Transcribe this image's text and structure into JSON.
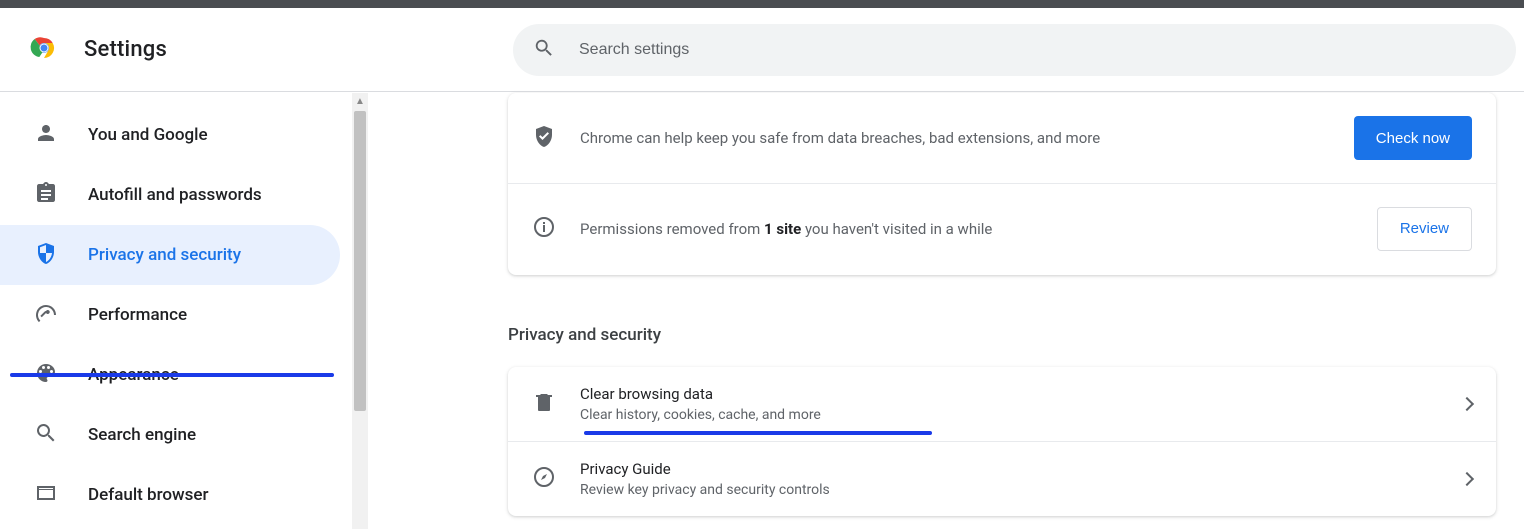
{
  "header": {
    "title": "Settings",
    "search_placeholder": "Search settings"
  },
  "sidebar": {
    "items": [
      {
        "id": "you-google",
        "label": "You and Google",
        "icon": "person"
      },
      {
        "id": "autofill",
        "label": "Autofill and passwords",
        "icon": "assignment"
      },
      {
        "id": "privacy",
        "label": "Privacy and security",
        "icon": "shield",
        "active": true
      },
      {
        "id": "performance",
        "label": "Performance",
        "icon": "speed"
      },
      {
        "id": "appearance",
        "label": "Appearance",
        "icon": "palette"
      },
      {
        "id": "search-engine",
        "label": "Search engine",
        "icon": "search"
      },
      {
        "id": "default-browser",
        "label": "Default browser",
        "icon": "browser"
      }
    ]
  },
  "safety": {
    "breach_text": "Chrome can help keep you safe from data breaches, bad extensions, and more",
    "check_now": "Check now",
    "perm_prefix": "Permissions removed from ",
    "perm_count": "1 site",
    "perm_suffix": " you haven't visited in a while",
    "review": "Review"
  },
  "section": {
    "heading": "Privacy and security",
    "items": [
      {
        "id": "clear-data",
        "title": "Clear browsing data",
        "desc": "Clear history, cookies, cache, and more",
        "icon": "trash"
      },
      {
        "id": "privacy-guide",
        "title": "Privacy Guide",
        "desc": "Review key privacy and security controls",
        "icon": "compass"
      }
    ]
  }
}
